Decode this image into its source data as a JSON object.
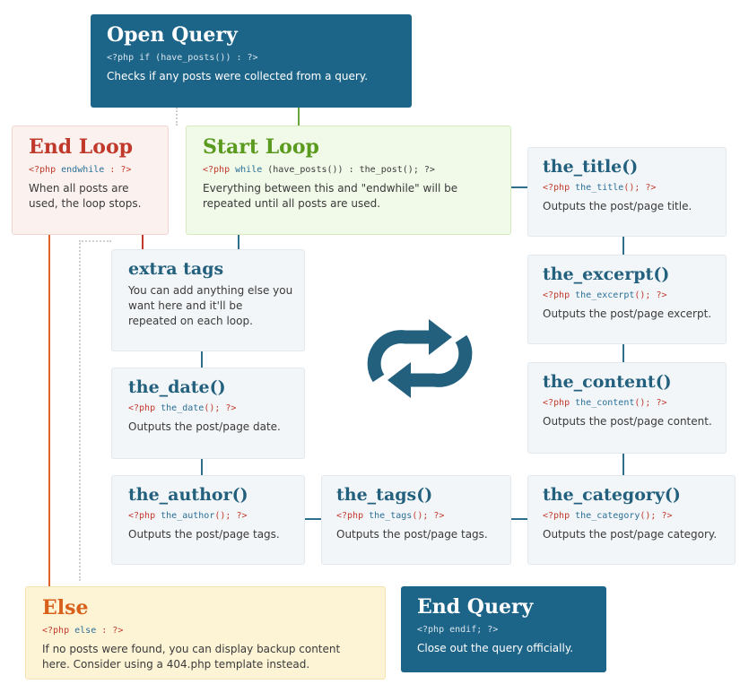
{
  "open_query": {
    "title": "Open Query",
    "code": "<?php if (have_posts()) : ?>",
    "desc": "Checks if any posts were collected from a query."
  },
  "end_loop": {
    "title": "End Loop",
    "code_kw": "<?php",
    "code_fn": "endwhile",
    "code_rest": " : ?>",
    "desc": "When all posts are used, the loop stops."
  },
  "start_loop": {
    "title": "Start Loop",
    "code_kw": "<?php",
    "code_fn": "while",
    "code_rest": " (have_posts()) : the_post(); ?>",
    "desc": "Everything between this and \"endwhile\" will be repeated until all posts are used."
  },
  "the_title": {
    "title": "the_title()",
    "code_kw": "<?php",
    "code_fn": "the_title",
    "code_rest": "(); ?>",
    "desc": "Outputs the post/page title."
  },
  "extra_tags": {
    "title": "extra tags",
    "desc": "You can add anything else you want here and it'll be repeated on each loop."
  },
  "the_excerpt": {
    "title": "the_excerpt()",
    "code_kw": "<?php",
    "code_fn": "the_excerpt",
    "code_rest": "(); ?>",
    "desc": "Outputs the post/page excerpt."
  },
  "the_date": {
    "title": "the_date()",
    "code_kw": "<?php",
    "code_fn": "the_date",
    "code_rest": "(); ?>",
    "desc": "Outputs the post/page date."
  },
  "the_content": {
    "title": "the_content()",
    "code_kw": "<?php",
    "code_fn": "the_content",
    "code_rest": "(); ?>",
    "desc": "Outputs the post/page content."
  },
  "the_author": {
    "title": "the_author()",
    "code_kw": "<?php",
    "code_fn": "the_author",
    "code_rest": "(); ?>",
    "desc": "Outputs the post/page tags."
  },
  "the_tags": {
    "title": "the_tags()",
    "code_kw": "<?php",
    "code_fn": "the_tags",
    "code_rest": "(); ?>",
    "desc": "Outputs the post/page tags."
  },
  "the_category": {
    "title": "the_category()",
    "code_kw": "<?php",
    "code_fn": "the_category",
    "code_rest": "(); ?>",
    "desc": "Outputs the post/page category."
  },
  "else_box": {
    "title": "Else",
    "code_kw": "<?php",
    "code_fn": "else",
    "code_rest": " : ?>",
    "desc": "If no posts were found, you can display backup content here. Consider using a 404.php template instead."
  },
  "end_query": {
    "title": "End Query",
    "code": "<?php endif; ?>",
    "desc": "Close out the query officially."
  },
  "icon": "loop-icon",
  "colors": {
    "primary": "#1d6489",
    "green": "#5a9a1e",
    "red": "#c0392b",
    "orange": "#d9601a",
    "connector": "#2e6f8e"
  }
}
